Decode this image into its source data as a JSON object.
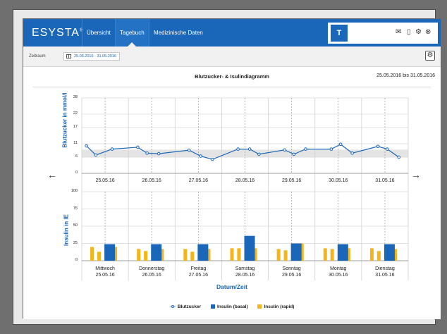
{
  "header": {
    "logo": "ESYSTA",
    "tabs": [
      {
        "label": "Übersicht"
      },
      {
        "label": "Tagebuch",
        "active": true
      },
      {
        "label": "Medizinische Daten"
      }
    ],
    "right_icons": [
      "mail-icon",
      "device-icon",
      "gear-icon",
      "close-icon"
    ]
  },
  "toolbar": {
    "zeitraum_label": "Zeitraum",
    "date_range": "25.05.2016 - 31.05.2016"
  },
  "chart": {
    "title": "Blutzucker- & Isulindiagramm",
    "range": "25.05.2016 bis 31.05.2016",
    "y_title_top": "Blutzucker in mmol/l",
    "y_title_bottom": "Insulin in IE",
    "x_title": "Datum/Zeit",
    "legend": {
      "blutzucker": "Blutzucker",
      "basal": "Insulin (basal)",
      "rapid": "Insulin (rapid)"
    },
    "colors": {
      "blutzucker": "#1a66b8",
      "basal": "#1a66b8",
      "rapid": "#f3b51b",
      "target_band": "#e4e4e4"
    }
  },
  "chart_data": [
    {
      "type": "line",
      "title": "Blutzucker- & Isulindiagramm",
      "ylabel": "Blutzucker in mmol/l",
      "ylim": [
        0,
        28
      ],
      "yticks": [
        0,
        6,
        11,
        17,
        22,
        28
      ],
      "target_range": [
        6,
        8.8
      ],
      "dates": [
        "25.05.16",
        "26.05.16",
        "27.05.16",
        "28.05.16",
        "29.05.16",
        "30.05.16",
        "31.05.16"
      ],
      "series": [
        {
          "name": "Blutzucker",
          "points": [
            {
              "day": 0.1,
              "y": 10.2
            },
            {
              "day": 0.3,
              "y": 6.8
            },
            {
              "day": 0.65,
              "y": 9.0
            },
            {
              "day": 1.2,
              "y": 9.7
            },
            {
              "day": 1.4,
              "y": 7.5
            },
            {
              "day": 1.65,
              "y": 7.3
            },
            {
              "day": 2.3,
              "y": 8.6
            },
            {
              "day": 2.55,
              "y": 6.4
            },
            {
              "day": 2.8,
              "y": 5.2
            },
            {
              "day": 3.35,
              "y": 9.0
            },
            {
              "day": 3.6,
              "y": 9.0
            },
            {
              "day": 3.8,
              "y": 7.1
            },
            {
              "day": 4.35,
              "y": 8.7
            },
            {
              "day": 4.55,
              "y": 7.1
            },
            {
              "day": 4.8,
              "y": 9.0
            },
            {
              "day": 5.35,
              "y": 9.0
            },
            {
              "day": 5.55,
              "y": 10.8
            },
            {
              "day": 5.8,
              "y": 7.5
            },
            {
              "day": 6.35,
              "y": 10.0
            },
            {
              "day": 6.55,
              "y": 9.0
            },
            {
              "day": 6.8,
              "y": 6.0
            }
          ]
        }
      ]
    },
    {
      "type": "bar",
      "ylabel": "Insulin in IE",
      "ylim": [
        0,
        100
      ],
      "yticks": [
        0,
        25,
        50,
        75,
        100
      ],
      "xlabel": "Datum/Zeit",
      "categories": [
        {
          "day": "Mittwoch",
          "date": "25.05.16"
        },
        {
          "day": "Donnerstag",
          "date": "26.05.16"
        },
        {
          "day": "Freitag",
          "date": "27.05.16"
        },
        {
          "day": "Samstag",
          "date": "28.05.16"
        },
        {
          "day": "Sonntag",
          "date": "29.05.16"
        },
        {
          "day": "Montag",
          "date": "30.05.16"
        },
        {
          "day": "Dienstag",
          "date": "31.05.16"
        }
      ],
      "series": [
        {
          "name": "Insulin (basal)",
          "values": [
            24,
            24,
            24,
            36,
            25,
            24,
            24
          ]
        },
        {
          "name": "Insulin (rapid)",
          "rapid_bars": [
            [
              20,
              13,
              0,
              20
            ],
            [
              17,
              14,
              4,
              17
            ],
            [
              17,
              13,
              3,
              17
            ],
            [
              18,
              18,
              4,
              18
            ],
            [
              17,
              15,
              4,
              25
            ],
            [
              18,
              17,
              4,
              18
            ],
            [
              18,
              14,
              4,
              17
            ]
          ]
        }
      ]
    }
  ]
}
